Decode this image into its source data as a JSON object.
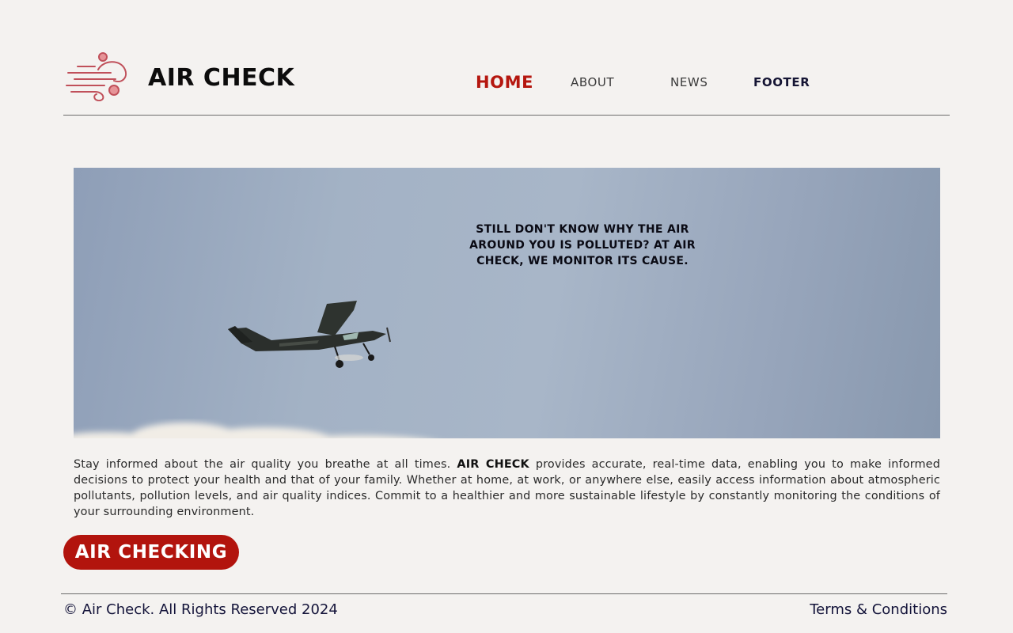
{
  "header": {
    "brand": "AIR CHECK",
    "logo_icon": "wind-icon",
    "nav": [
      {
        "label": "HOME",
        "active": true
      },
      {
        "label": "ABOUT",
        "active": false
      },
      {
        "label": "NEWS",
        "active": false
      },
      {
        "label": "FOOTER",
        "active": false
      }
    ]
  },
  "hero": {
    "tagline": "STILL DON'T KNOW WHY THE AIR AROUND YOU IS POLLUTED? AT AIR CHECK, WE MONITOR ITS CAUSE."
  },
  "intro": {
    "text_before": "Stay informed about the air quality you breathe at all times. ",
    "brand": "AIR CHECK",
    "text_after": " provides accurate, real-time data, enabling you to make informed decisions to protect your health and that of your family. Whether at home, at work, or anywhere else, easily access information about atmospheric pollutants, pollution levels, and air quality indices. Commit to a healthier and more sustainable lifestyle by constantly monitoring the conditions of your surrounding environment."
  },
  "cta": {
    "label": "AIR CHECKING"
  },
  "footer": {
    "copyright": "© Air Check. All Rights Reserved 2024",
    "terms": "Terms & Conditions"
  },
  "colors": {
    "accent": "#b2140d",
    "background": "#f4f2f0",
    "footer_text": "#14143a",
    "logo": "#c0505a"
  }
}
